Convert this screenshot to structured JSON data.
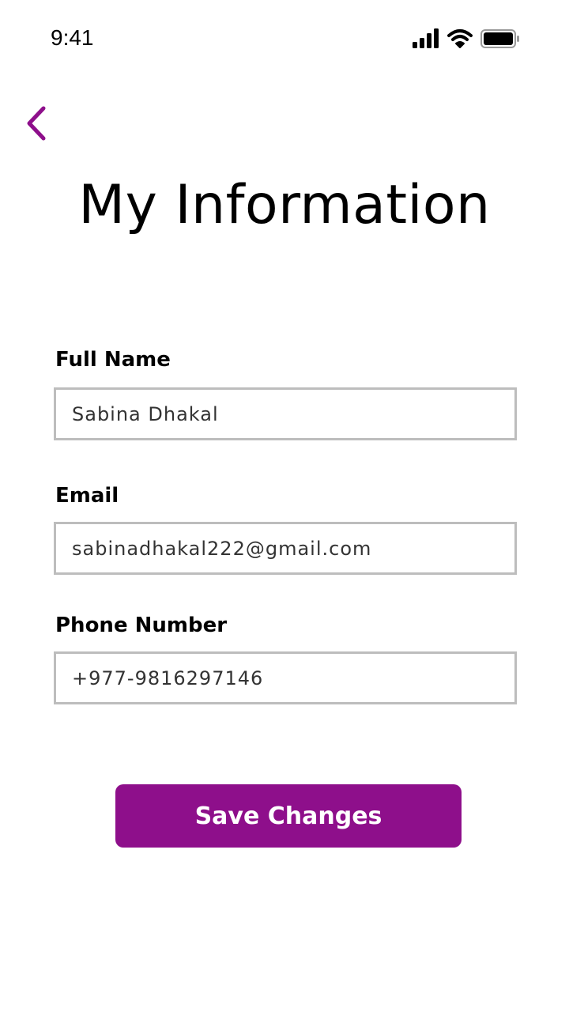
{
  "status_bar": {
    "time": "9:41",
    "icons": [
      "signal-icon",
      "wifi-icon",
      "battery-icon"
    ]
  },
  "header": {
    "back_icon": "chevron-left-icon",
    "title": "My Information"
  },
  "form": {
    "full_name": {
      "label": "Full Name",
      "value": "Sabina Dhakal"
    },
    "email": {
      "label": "Email",
      "value": "sabinadhakal222@gmail.com"
    },
    "phone": {
      "label": "Phone Number",
      "value": "+977-9816297146"
    }
  },
  "actions": {
    "save_label": "Save Changes"
  },
  "colors": {
    "accent": "#8e0f8b",
    "input_border": "#bdbdbd",
    "text": "#000000",
    "input_text": "#333333",
    "background": "#ffffff"
  }
}
